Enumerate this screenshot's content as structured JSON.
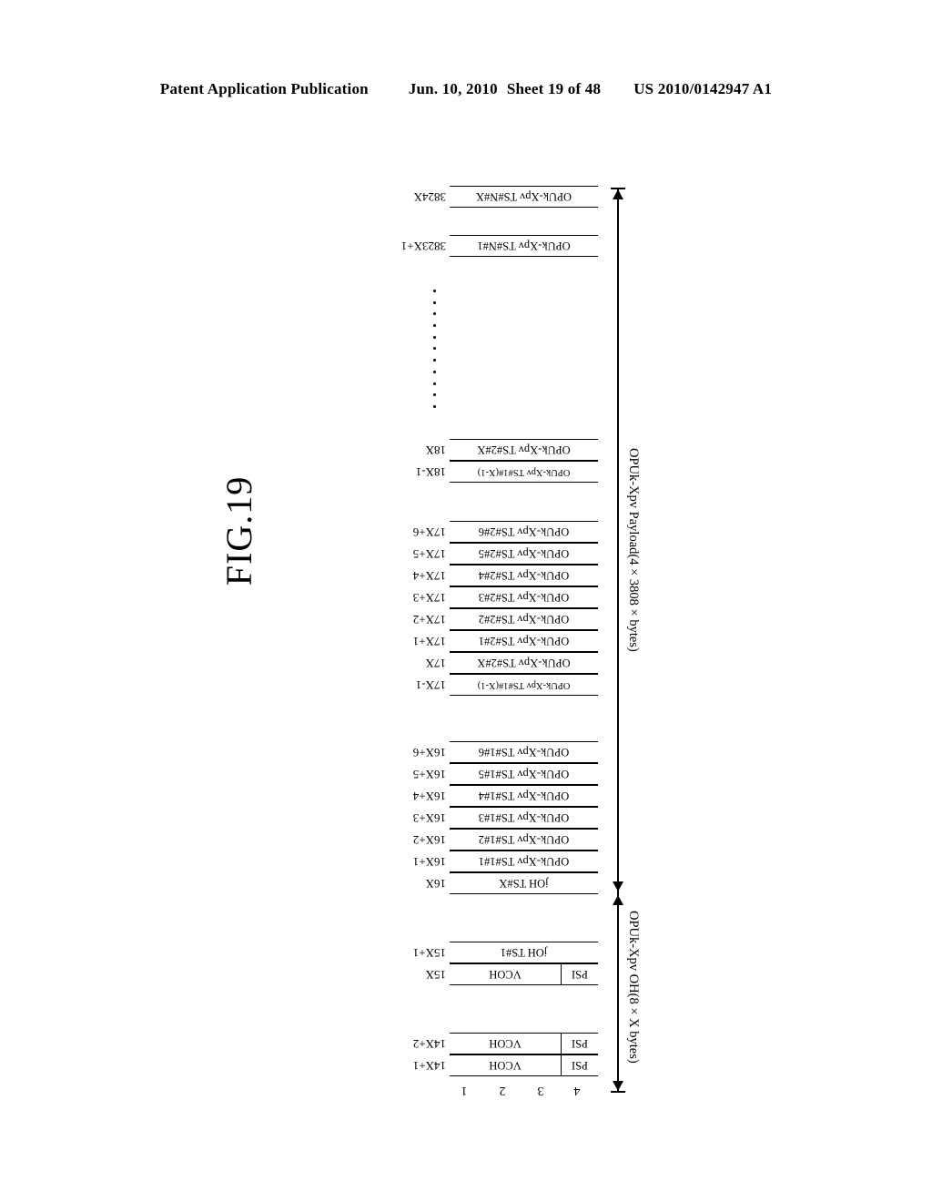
{
  "header": {
    "publication": "Patent Application Publication",
    "date": "Jun. 10, 2010",
    "sheet": "Sheet 19 of 48",
    "number": "US 2010/0142947 A1"
  },
  "figure": {
    "label": "FIG.19",
    "payload_block_label": "OPUk-Xpv Payload",
    "column_numbers": [
      "1",
      "2",
      "3",
      "4"
    ],
    "brackets": [
      {
        "name": "payload-bracket",
        "label": "OPUk-Xpv Payload(4 × 3808 × bytes)"
      },
      {
        "name": "overhead-bracket",
        "label": "OPUk-Xpv OH(8 × X bytes)"
      }
    ],
    "rows": [
      {
        "index": "3824X",
        "text": "OPUk-Xpv TS#N#X",
        "type": "single"
      },
      {
        "index": "",
        "text": "",
        "type": "blank"
      },
      {
        "index": "3823X+1",
        "text": "OPUk-Xpv TS#N#1",
        "type": "single"
      },
      {
        "index": "",
        "text": "",
        "type": "payload"
      },
      {
        "index": "18X",
        "text": "OPUk-Xpv TS#2#X",
        "type": "single"
      },
      {
        "index": "18X-1",
        "text": "OPUk-Xpv TS#1#(X-1)",
        "type": "single"
      },
      {
        "index": "",
        "text": "",
        "type": "blank"
      },
      {
        "index": "17X+6",
        "text": "OPUk-Xpv TS#2#6",
        "type": "single"
      },
      {
        "index": "17X+5",
        "text": "OPUk-Xpv TS#2#5",
        "type": "single"
      },
      {
        "index": "17X+4",
        "text": "OPUk-Xpv TS#2#4",
        "type": "single"
      },
      {
        "index": "17X+3",
        "text": "OPUk-Xpv TS#2#3",
        "type": "single"
      },
      {
        "index": "17X+2",
        "text": "OPUk-Xpv TS#2#2",
        "type": "single"
      },
      {
        "index": "17X+1",
        "text": "OPUk-Xpv TS#2#1",
        "type": "single"
      },
      {
        "index": "17X",
        "text": "OPUk-Xpv TS#2#X",
        "type": "single"
      },
      {
        "index": "17X-1",
        "text": "OPUk-Xpv TS#1#(X-1)",
        "type": "single"
      },
      {
        "index": "",
        "text": "",
        "type": "blank"
      },
      {
        "index": "16X+6",
        "text": "OPUk-Xpv TS#1#6",
        "type": "single"
      },
      {
        "index": "16X+5",
        "text": "OPUk-Xpv TS#1#5",
        "type": "single"
      },
      {
        "index": "16X+4",
        "text": "OPUk-Xpv TS#1#4",
        "type": "single"
      },
      {
        "index": "16X+3",
        "text": "OPUk-Xpv TS#1#3",
        "type": "single"
      },
      {
        "index": "16X+2",
        "text": "OPUk-Xpv TS#1#2",
        "type": "single"
      },
      {
        "index": "16X+1",
        "text": "OPUk-Xpv TS#1#1",
        "type": "single"
      },
      {
        "index": "16X",
        "text": "jOH TS#X",
        "type": "single"
      },
      {
        "index": "",
        "text": "",
        "type": "blank"
      },
      {
        "index": "15X+1",
        "text": "jOH TS#1",
        "type": "single"
      },
      {
        "index": "15X",
        "text": "VCOH",
        "text2": "PSI",
        "type": "split"
      },
      {
        "index": "",
        "text": "",
        "type": "blank"
      },
      {
        "index": "14X+2",
        "text": "VCOH",
        "text2": "PSI",
        "type": "split"
      },
      {
        "index": "14X+1",
        "text": "VCOH",
        "text2": "PSI",
        "type": "split"
      }
    ]
  }
}
